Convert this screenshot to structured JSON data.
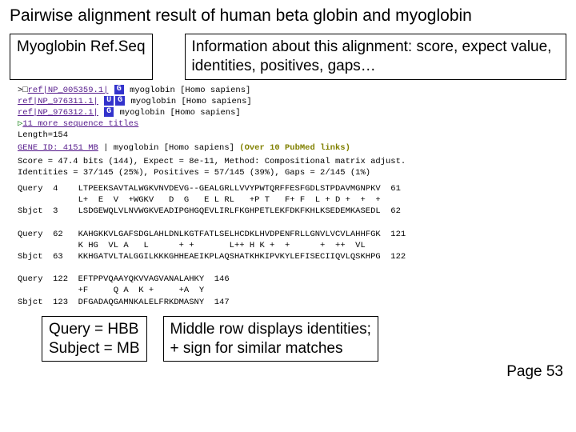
{
  "title": "Pairwise alignment result of human beta globin and myoglobin",
  "label_left": "Myoglobin Ref.Seq",
  "info_box": "Information about this alignment: score, expect value, identities, positives, gaps…",
  "ref1_id": "ref|NP_005359.1|",
  "refs_desc": "myoglobin [Homo sapiens]",
  "badge_G": "G",
  "badge_U": "U",
  "ref2_id": "ref|NP_976311.1|",
  "ref3_id": "ref|NP_976312.1|",
  "more_titles": "11 more sequence titles",
  "length": "Length=154",
  "gene_line_a": "GENE ID: 4151 MB",
  "gene_line_b": " | myoglobin [Homo sapiens] ",
  "gene_line_c": "(Over 10 PubMed links)",
  "score_line": "Score = 47.4 bits (144),  Expect = 8e-11, Method: Compositional matrix adjust.",
  "ident_line": "Identities = 37/145 (25%), Positives = 57/145 (39%), Gaps = 2/145 (1%)",
  "alignment": "Query  4    LTPEEKSAVTALWGKVNVDEVG--GEALGRLLVVYPWTQRFFESFGDLSTPDAVMGNPKV  61\n            L+  E  V  +WGKV   D  G   E L RL   +P T   F+ F  L + D +  +  +\nSbjct  3    LSDGEWQLVLNVWGKVEADIPGHGQEVLIRLFKGHPETLEKFDKFKHLKSEDEMKASEDL  62\n\nQuery  62   KAHGKKVLGAFSDGLAHLDNLKGTFATLSELHCDKLHVDPENFRLLGNVLVCVLAHHFGK  121\n            K HG  VL A   L      + +       L++ H K +  +      +  ++  VL\nSbjct  63   KKHGATVLTALGGILKKKGHHEAEIKPLAQSHATKHKIPVKYLEFISECIIQVLQSKHPG  122\n\nQuery  122  EFTPPVQAAYQKVVAGVANALAHKY  146\n            +F     Q A  K +     +A  Y\nSbjct  123  DFGADAQGAMNKALELFRKDMASNY  147",
  "query_sub": "Query = HBB\nSubject = MB",
  "middle_box": "Middle row displays identities;\n+ sign for similar matches",
  "page": "Page 53"
}
